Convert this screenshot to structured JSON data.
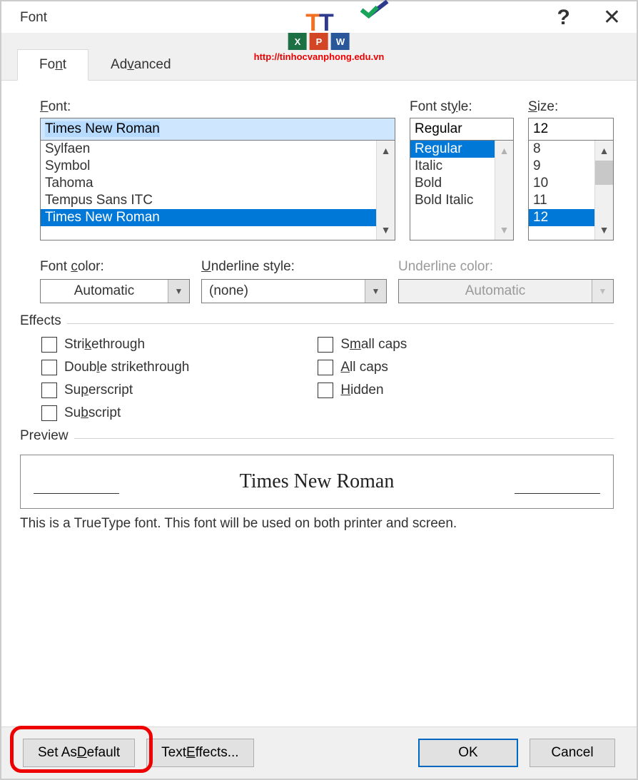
{
  "title": "Font",
  "overlay_url": "http://tinhocvanphong.edu.vn",
  "tabs": {
    "font": "Font",
    "advanced": "Advanced"
  },
  "fontSection": {
    "label": "Font:",
    "value": "Times New Roman",
    "list": [
      "Sylfaen",
      "Symbol",
      "Tahoma",
      "Tempus Sans ITC",
      "Times New Roman"
    ],
    "selectedIndex": 4
  },
  "styleSection": {
    "label": "Font style:",
    "value": "Regular",
    "list": [
      "Regular",
      "Italic",
      "Bold",
      "Bold Italic"
    ],
    "selectedIndex": 0
  },
  "sizeSection": {
    "label": "Size:",
    "value": "12",
    "list": [
      "8",
      "9",
      "10",
      "11",
      "12"
    ],
    "selectedIndex": 4
  },
  "fontColor": {
    "label": "Font color:",
    "value": "Automatic"
  },
  "underlineStyle": {
    "label": "Underline style:",
    "value": "(none)"
  },
  "underlineColor": {
    "label": "Underline color:",
    "value": "Automatic"
  },
  "effects": {
    "legend": "Effects",
    "left": [
      "Strikethrough",
      "Double strikethrough",
      "Superscript",
      "Subscript"
    ],
    "right": [
      "Small caps",
      "All caps",
      "Hidden"
    ]
  },
  "preview": {
    "legend": "Preview",
    "sample": "Times New Roman",
    "desc": "This is a TrueType font. This font will be used on both printer and screen."
  },
  "buttons": {
    "setDefault": "Set As Default",
    "textEffects": "Text Effects...",
    "ok": "OK",
    "cancel": "Cancel"
  }
}
